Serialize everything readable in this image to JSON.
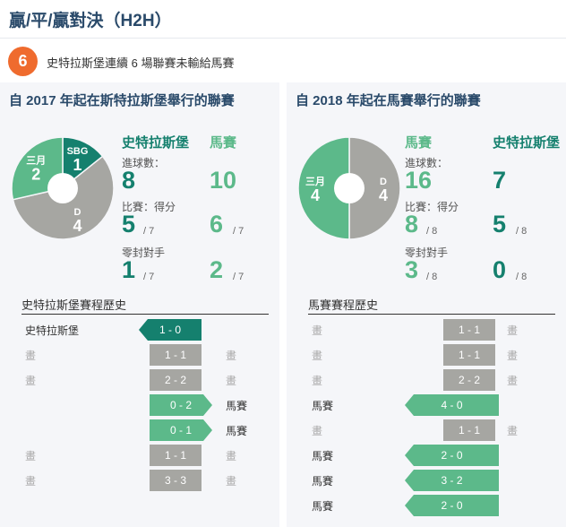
{
  "title": "贏/平/贏對決（H2H）",
  "streak": {
    "count": "6",
    "text": "史特拉斯堡連續 6 場聯賽未輸給馬賽"
  },
  "colors": {
    "teal": "#15806e",
    "green": "#5cb98a",
    "grey": "#a6a6a2",
    "badge": "#ef6b2e"
  },
  "panels": [
    {
      "title": "自 2017 年起在斯特拉斯堡舉行的聯賽",
      "teams": [
        {
          "name": "史特拉斯堡",
          "color": "teal",
          "goals": "8",
          "wins": "5",
          "clean": "1"
        },
        {
          "name": "馬賽",
          "color": "green",
          "goals": "10",
          "wins": "6",
          "clean": "2"
        }
      ],
      "labels": {
        "goals": "進球數：",
        "wins": "比賽：得分",
        "clean": "零封對手"
      },
      "denom": "/ 7",
      "pie": {
        "segments": [
          {
            "label": "SBG",
            "value": 1,
            "color": "teal"
          },
          {
            "label": "D",
            "value": 4,
            "color": "grey"
          },
          {
            "label": "三月",
            "value": 2,
            "color": "green"
          }
        ]
      },
      "history_title": "史特拉斯堡賽程歷史",
      "history": [
        {
          "left": "史特拉斯堡",
          "score": "1 - 0",
          "type": "win-left",
          "right": ""
        },
        {
          "left": "畫",
          "score": "1 - 1",
          "type": "draw",
          "right": "畫"
        },
        {
          "left": "畫",
          "score": "2 - 2",
          "type": "draw",
          "right": "畫"
        },
        {
          "left": "",
          "score": "0 - 2",
          "type": "win-right",
          "right": "馬賽"
        },
        {
          "left": "",
          "score": "0 - 1",
          "type": "win-right",
          "right": "馬賽"
        },
        {
          "left": "畫",
          "score": "1 - 1",
          "type": "draw",
          "right": "畫"
        },
        {
          "left": "畫",
          "score": "3 - 3",
          "type": "draw",
          "right": "畫"
        }
      ]
    },
    {
      "title": "自 2018 年起在馬賽舉行的聯賽",
      "teams": [
        {
          "name": "馬賽",
          "color": "green",
          "goals": "16",
          "wins": "8",
          "clean": "3"
        },
        {
          "name": "史特拉斯堡",
          "color": "teal",
          "goals": "7",
          "wins": "5",
          "clean": "0"
        }
      ],
      "labels": {
        "goals": "進球數：",
        "wins": "比賽：得分",
        "clean": "零封對手"
      },
      "denom": "/ 8",
      "pie": {
        "segments": [
          {
            "label": "D",
            "value": 4,
            "color": "grey"
          },
          {
            "label": "三月",
            "value": 4,
            "color": "green"
          }
        ]
      },
      "history_title": "馬賽賽程歷史",
      "history": [
        {
          "left": "畫",
          "score": "1 - 1",
          "type": "draw",
          "right": "畫"
        },
        {
          "left": "畫",
          "score": "1 - 1",
          "type": "draw",
          "right": "畫"
        },
        {
          "left": "畫",
          "score": "2 - 2",
          "type": "draw",
          "right": "畫"
        },
        {
          "left": "馬賽",
          "score": "4 - 0",
          "type": "win-left",
          "right": ""
        },
        {
          "left": "畫",
          "score": "1 - 1",
          "type": "draw",
          "right": "畫"
        },
        {
          "left": "馬賽",
          "score": "2 - 0",
          "type": "win-left",
          "right": ""
        },
        {
          "left": "馬賽",
          "score": "3 - 2",
          "type": "win-left",
          "right": ""
        },
        {
          "left": "馬賽",
          "score": "2 - 0",
          "type": "win-left",
          "right": ""
        }
      ]
    }
  ]
}
